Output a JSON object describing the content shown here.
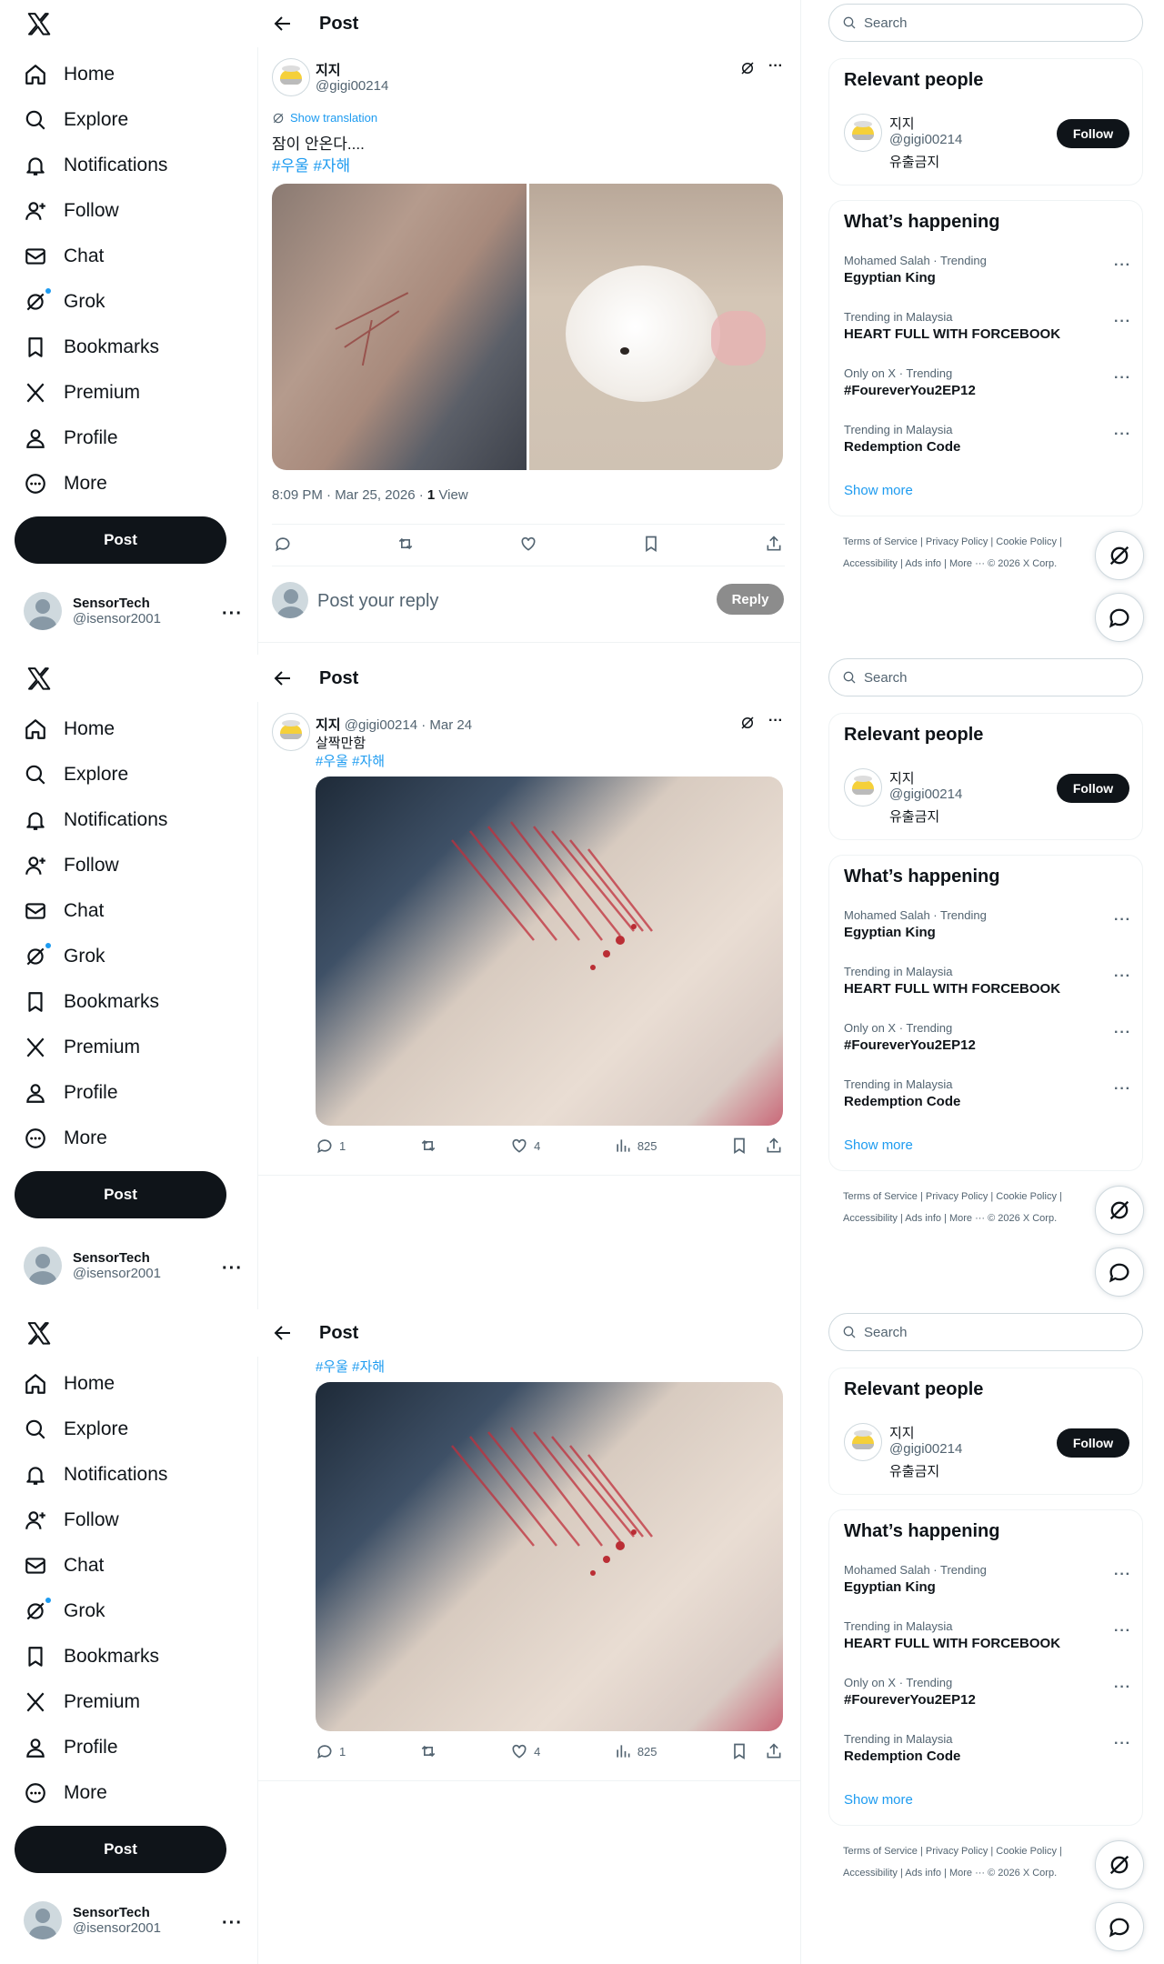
{
  "nav": {
    "items": [
      {
        "label": "Home",
        "icon": "home-icon"
      },
      {
        "label": "Explore",
        "icon": "search-icon"
      },
      {
        "label": "Notifications",
        "icon": "bell-icon"
      },
      {
        "label": "Follow",
        "icon": "add-user-icon"
      },
      {
        "label": "Chat",
        "icon": "mail-icon"
      },
      {
        "label": "Grok",
        "icon": "grok-icon"
      },
      {
        "label": "Bookmarks",
        "icon": "bookmark-icon"
      },
      {
        "label": "Premium",
        "icon": "x-logo-icon"
      },
      {
        "label": "Profile",
        "icon": "person-icon"
      },
      {
        "label": "More",
        "icon": "more-circle-icon"
      }
    ],
    "post_label": "Post",
    "me_name": "SensorTech",
    "me_handle": "@isensor2001"
  },
  "header": {
    "title": "Post"
  },
  "post1": {
    "name": "지지",
    "handle": "@gigi00214",
    "show_translation": "Show translation",
    "text": "잠이 안온다....",
    "hashtags": "#우울 #자해",
    "time": "8:09 PM · Mar 25, 2026 · ",
    "views_count": "1",
    "views_label": " View",
    "reply_placeholder": "Post your reply",
    "reply_button": "Reply"
  },
  "post2": {
    "name": "지지",
    "handle": "@gigi00214 · Mar 24",
    "text": "살짝만함",
    "hashtags": "#우울 #자해",
    "replies": "1",
    "likes": "4",
    "views": "825"
  },
  "right": {
    "search_placeholder": "Search",
    "relevant_title": "Relevant people",
    "person_name": "지지",
    "person_handle": "@gigi00214",
    "person_bio": "유출금지",
    "follow_label": "Follow",
    "happening_title": "What’s happening",
    "trends": [
      {
        "meta": "Mohamed Salah · Trending",
        "title": "Egyptian King"
      },
      {
        "meta": "Trending in Malaysia",
        "title": "HEART FULL WITH FORCEBOOK"
      },
      {
        "meta": "Only on X · Trending",
        "title": "#FoureverYou2EP12"
      },
      {
        "meta": "Trending in Malaysia",
        "title": "Redemption Code"
      }
    ],
    "show_more": "Show more",
    "footer_line1": "Terms of Service  |   Privacy Policy  |   Cookie Policy  |",
    "footer_line2": "Accessibility  |   Ads info  |   More ···   © 2026 X Corp."
  },
  "colors": {
    "accent": "#1d9bf0",
    "text": "#0f1419",
    "muted": "#536471",
    "border": "#eff3f4"
  }
}
